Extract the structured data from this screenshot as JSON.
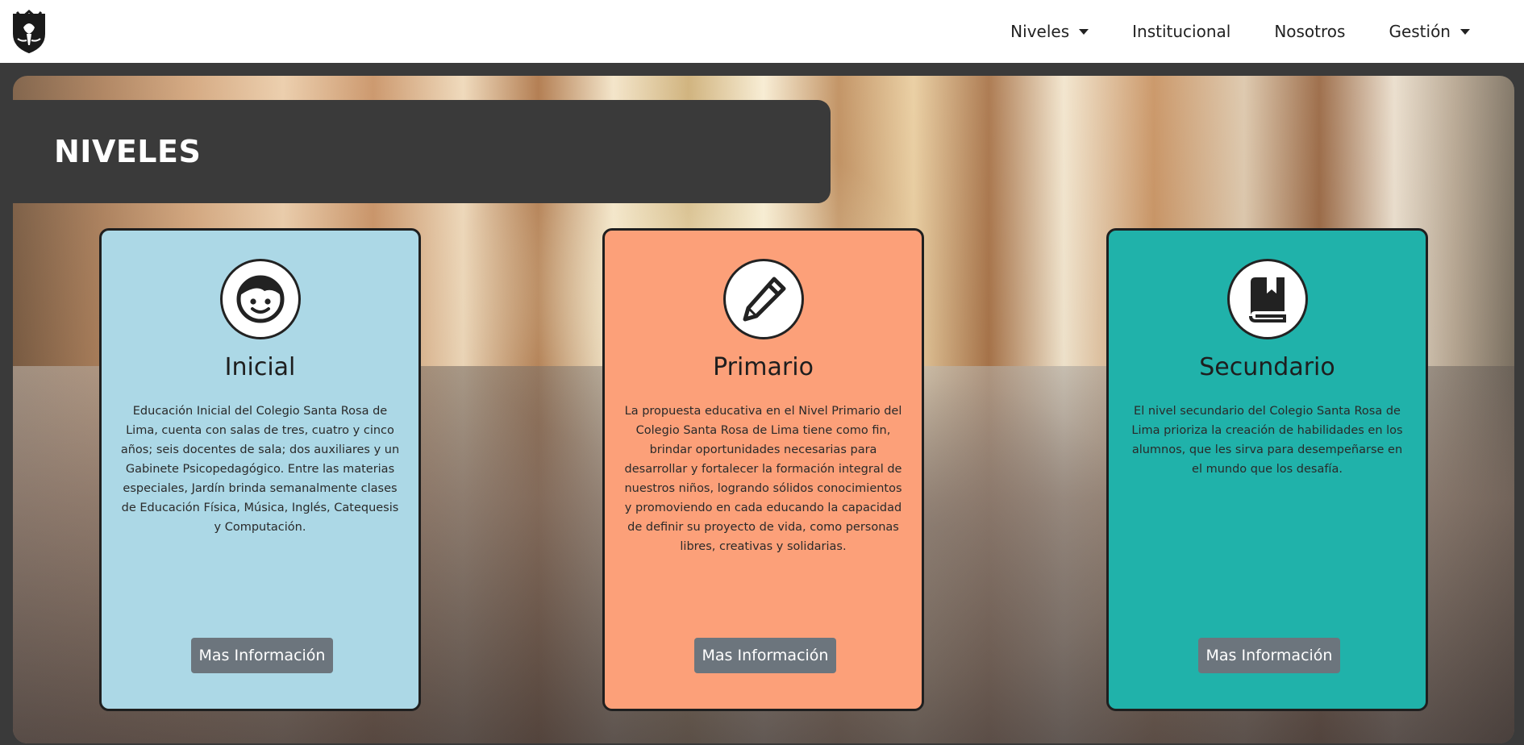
{
  "navbar": {
    "logo_name": "school-crest-logo",
    "items": [
      {
        "label": "Niveles",
        "dropdown": true
      },
      {
        "label": "Institucional",
        "dropdown": false
      },
      {
        "label": "Nosotros",
        "dropdown": false
      },
      {
        "label": "Gestión",
        "dropdown": true
      }
    ]
  },
  "hero": {
    "title": "NIVELES"
  },
  "cards": [
    {
      "title": "Inicial",
      "icon": "child-face-icon",
      "color": "#acd8e6",
      "text": "Educación Inicial del Colegio Santa Rosa de Lima, cuenta con salas de tres, cuatro y cinco años; seis docentes de sala; dos auxiliares y un Gabinete Psicopedagógico. Entre las materias especiales, Jardín brinda semanalmente clases de Educación Física, Música, Inglés, Catequesis y Computación.",
      "button": "Mas Información"
    },
    {
      "title": "Primario",
      "icon": "pencil-icon",
      "color": "#fca079",
      "text": "La propuesta educativa en el Nivel Primario del Colegio Santa Rosa de Lima tiene como fin, brindar oportunidades necesarias para desarrollar y fortalecer la formación integral de nuestros niños, logrando sólidos conocimientos y promoviendo en cada educando la capacidad de definir su proyecto de vida, como personas libres, creativas y solidarias.",
      "button": "Mas Información"
    },
    {
      "title": "Secundario",
      "icon": "book-icon",
      "color": "#20b2aa",
      "text": "El nivel secundario del Colegio Santa Rosa de Lima prioriza la creación de habilidades en los alumnos, que les sirva para desempeñarse en el mundo que los desafía.",
      "button": "Mas Información"
    }
  ],
  "colors": {
    "navbar_bg": "#ffffff",
    "page_bg": "#3a3a3a",
    "button_bg": "#6c757d"
  }
}
